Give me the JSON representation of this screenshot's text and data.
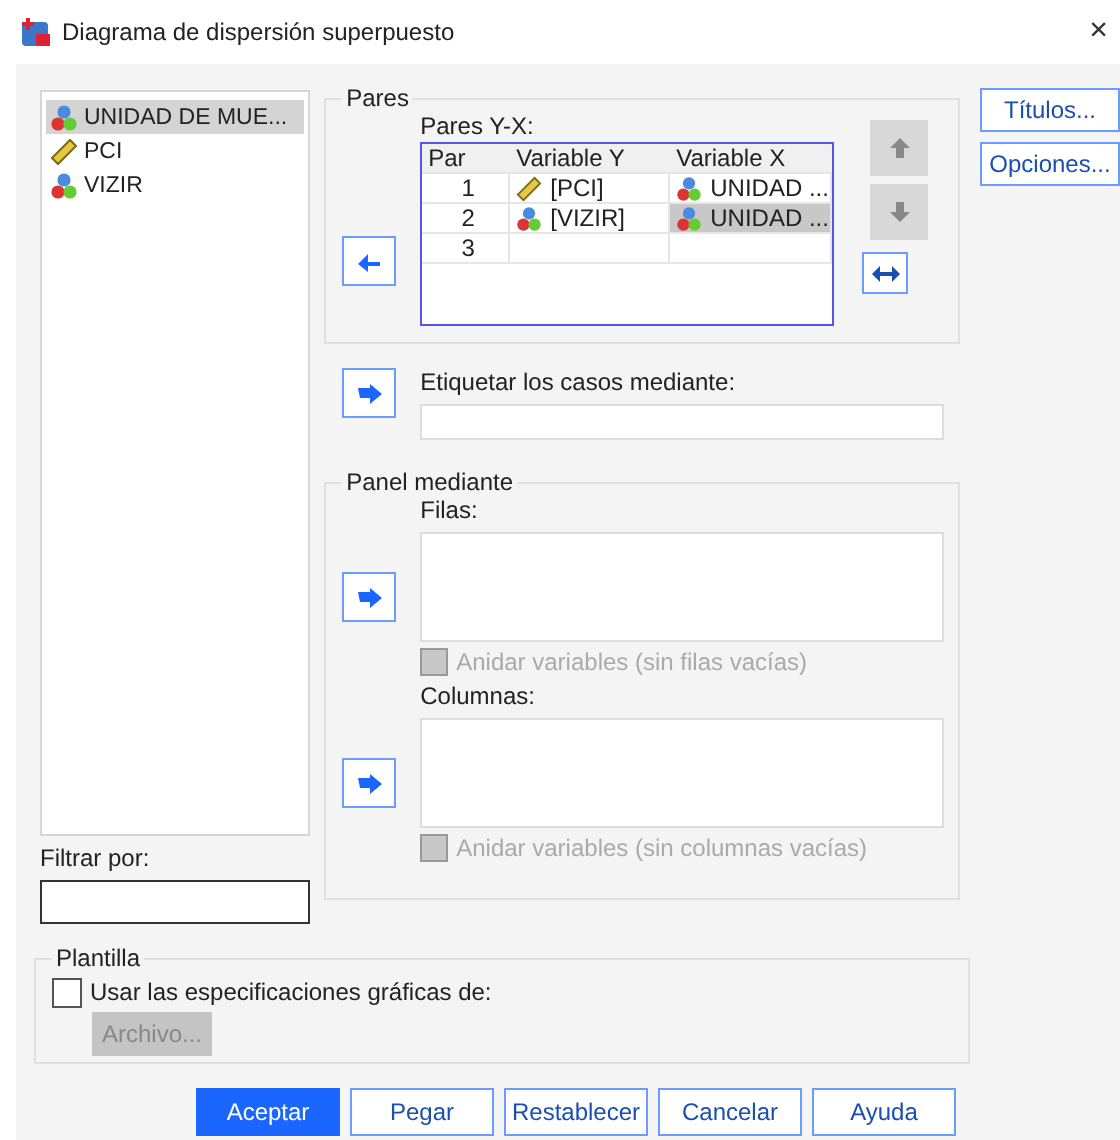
{
  "window": {
    "title": "Diagrama de dispersión superpuesto",
    "close": "×"
  },
  "variables": [
    {
      "name": "UNIDAD DE MUE...",
      "kind": "nominal",
      "selected": true
    },
    {
      "name": "PCI",
      "kind": "scale",
      "selected": false
    },
    {
      "name": "VIZIR",
      "kind": "nominal",
      "selected": false
    }
  ],
  "filter": {
    "label": "Filtrar por:"
  },
  "pairs": {
    "title": "Pares",
    "label": "Pares Y-X:",
    "columns": [
      "Par",
      "Variable Y",
      "Variable X"
    ],
    "rows": [
      {
        "par": "1",
        "y": {
          "name": "[PCI]",
          "kind": "scale"
        },
        "x": {
          "name": "UNIDAD ...",
          "kind": "nominal"
        },
        "selected": false
      },
      {
        "par": "2",
        "y": {
          "name": "[VIZIR]",
          "kind": "nominal"
        },
        "x": {
          "name": "UNIDAD ...",
          "kind": "nominal"
        },
        "selected": true
      },
      {
        "par": "3",
        "selected": false
      }
    ],
    "up_disabled": true,
    "down_disabled": true
  },
  "label_cases": {
    "label": "Etiquetar los casos mediante:"
  },
  "panel": {
    "title": "Panel mediante",
    "rows_label": "Filas:",
    "rows_nest": {
      "label": "Anidar variables (sin filas vacías)",
      "checked": false,
      "disabled": true
    },
    "cols_label": "Columnas:",
    "cols_nest": {
      "label": "Anidar variables (sin columnas vacías)",
      "checked": false,
      "disabled": true
    }
  },
  "side_buttons": [
    "Títulos...",
    "Opciones..."
  ],
  "template": {
    "title": "Plantilla",
    "checkbox": {
      "label": "Usar las especificaciones gráficas de:",
      "checked": false
    },
    "file_button": {
      "label": "Archivo...",
      "disabled": true
    }
  },
  "buttons": [
    {
      "label": "Aceptar",
      "primary": true
    },
    {
      "label": "Pegar",
      "primary": false
    },
    {
      "label": "Restablecer",
      "primary": false
    },
    {
      "label": "Cancelar",
      "primary": false
    },
    {
      "label": "Ayuda",
      "primary": false
    }
  ]
}
